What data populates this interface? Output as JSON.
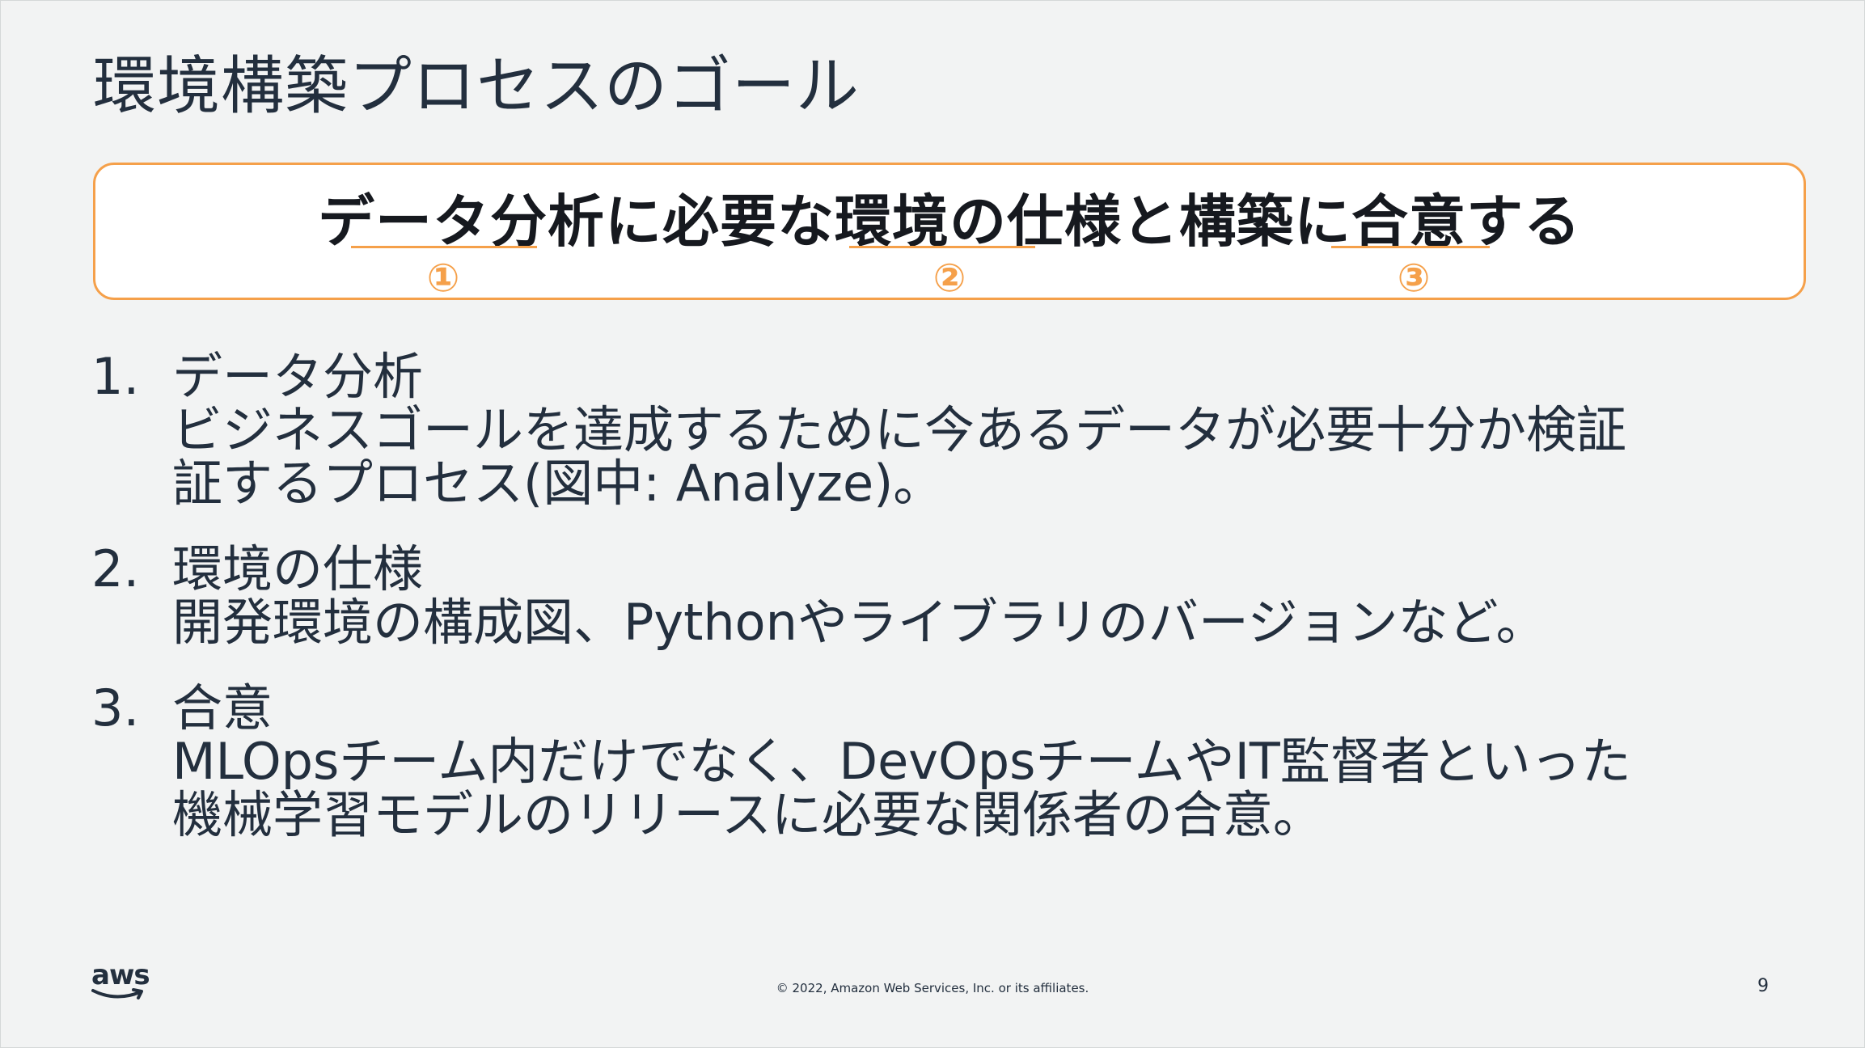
{
  "slide": {
    "title": "環境構築プロセスのゴール",
    "goal": {
      "text": "データ分析に必要な環境の仕様と構築に合意する",
      "markers": [
        "①",
        "②",
        "③"
      ]
    },
    "items": [
      {
        "number": "1.",
        "heading": "データ分析",
        "lines": [
          "ビジネスゴールを達成するために今あるデータが必要十分か検証",
          "証するプロセス(図中: Analyze)。"
        ]
      },
      {
        "number": "2.",
        "heading": "環境の仕様",
        "lines": [
          "開発環境の構成図、Pythonやライブラリのバージョンなど。"
        ]
      },
      {
        "number": "3.",
        "heading": "合意",
        "lines": [
          "MLOpsチーム内だけでなく、DevOpsチームやIT監督者といった",
          "機械学習モデルのリリースに必要な関係者の合意。"
        ]
      }
    ],
    "footer": {
      "logo_text": "aws",
      "copyright": "© 2022, Amazon Web Services, Inc. or its affiliates.",
      "page_number": "9"
    },
    "colors": {
      "accent": "#f5a04a",
      "text": "#232f3e",
      "background": "#f2f3f3"
    }
  }
}
